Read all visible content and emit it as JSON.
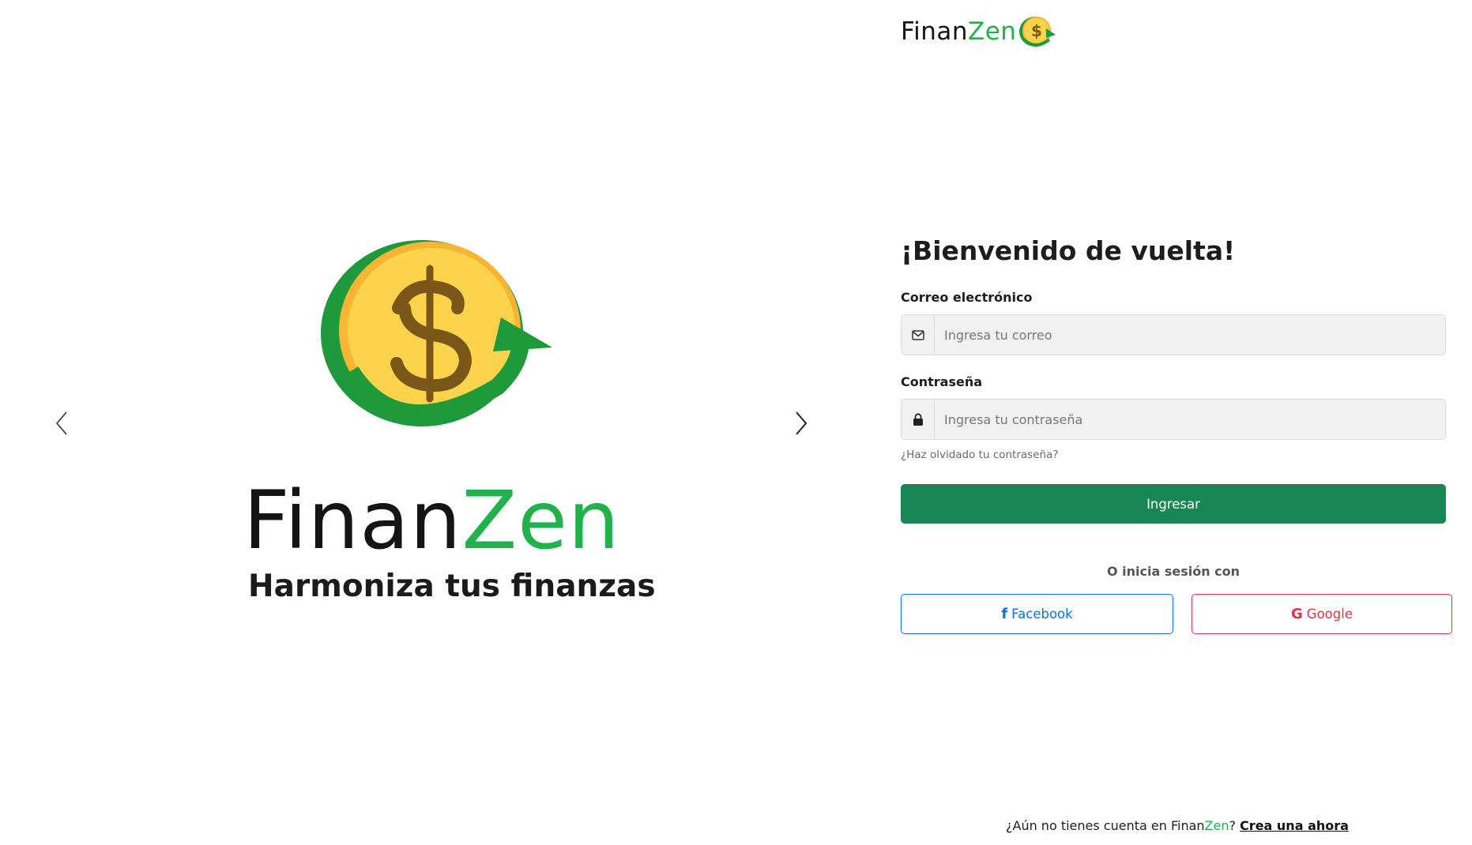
{
  "carousel": {
    "prev_icon": "chevron-left-icon",
    "next_icon": "chevron-right-icon",
    "slide": {
      "brand_part1": "Finan",
      "brand_part2": "Zen",
      "tagline": "Harmoniza tus finanzas"
    }
  },
  "header": {
    "brand_part1": "Finan",
    "brand_part2": "Zen"
  },
  "login": {
    "title": "¡Bienvenido de vuelta!",
    "email_label": "Correo electrónico",
    "email_placeholder": "Ingresa tu correo",
    "email_value": "",
    "email_icon": "envelope-icon",
    "password_label": "Contraseña",
    "password_placeholder": "Ingresa tu contraseña",
    "password_value": "",
    "password_icon": "lock-icon",
    "forgot_link": "¿Haz olvidado tu contraseña?",
    "submit_label": "Ingresar",
    "social_prompt": "O inicia sesión con",
    "facebook_label": "Facebook",
    "google_label": "Google"
  },
  "footer": {
    "prompt_before": "¿Aún no tienes cuenta en ",
    "brand_part1": "Finan",
    "brand_part2": "Zen",
    "prompt_after": "? ",
    "signup_link": "Crea una ahora"
  },
  "colors": {
    "brand_green": "#22b24c",
    "primary_button": "#198754",
    "facebook": "#0d6efd",
    "google": "#dc3545",
    "coin_gold": "#fcd34d",
    "arrow_green": "#1f9a3b"
  }
}
